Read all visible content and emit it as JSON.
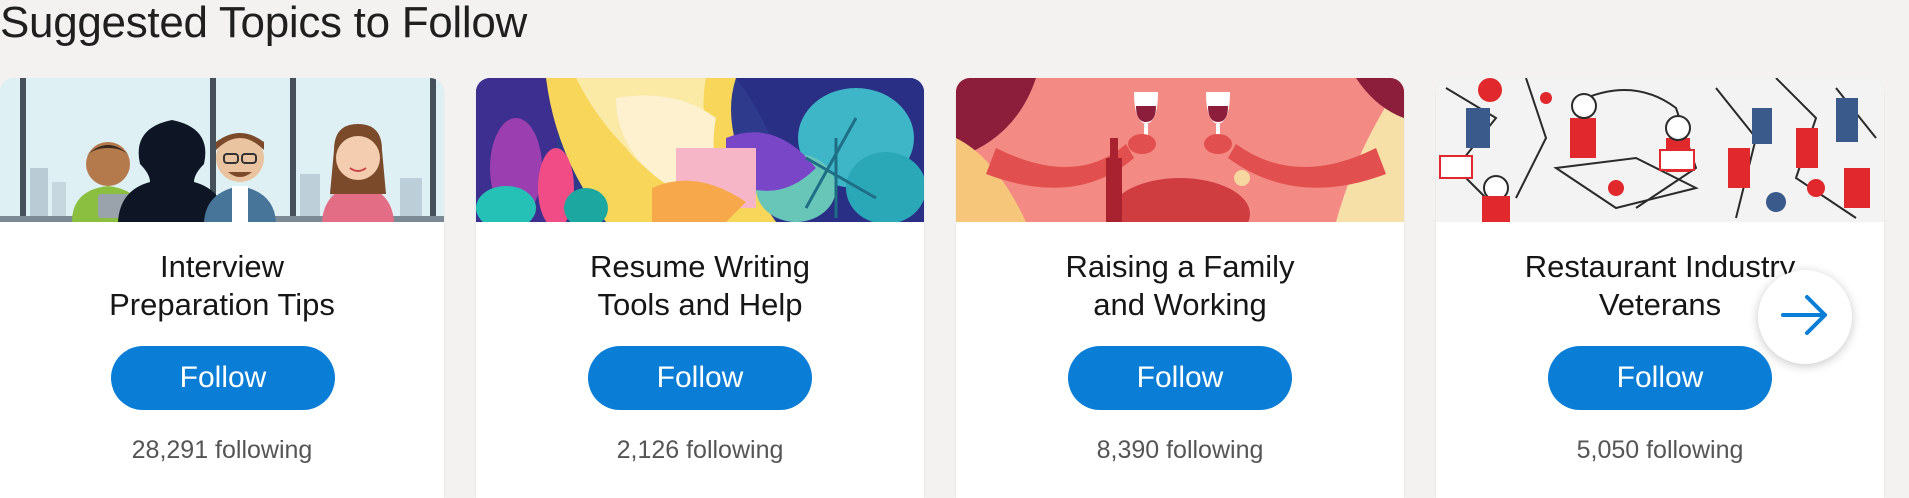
{
  "section": {
    "title": "Suggested Topics to Follow"
  },
  "topics": [
    {
      "title_line1": "Interview",
      "title_line2": "Preparation Tips",
      "follow_label": "Follow",
      "following": "28,291 following"
    },
    {
      "title_line1": "Resume Writing",
      "title_line2": "Tools and Help",
      "follow_label": "Follow",
      "following": "2,126 following"
    },
    {
      "title_line1": "Raising a Family",
      "title_line2": "and Working",
      "follow_label": "Follow",
      "following": "8,390 following"
    },
    {
      "title_line1": "Restaurant Industry",
      "title_line2": "Veterans",
      "follow_label": "Follow",
      "following": "5,050 following"
    }
  ],
  "carousel": {
    "next_icon": "arrow-right-icon"
  },
  "colors": {
    "accent": "#0a7ed6",
    "background": "#f3f2f1",
    "card": "#ffffff"
  }
}
